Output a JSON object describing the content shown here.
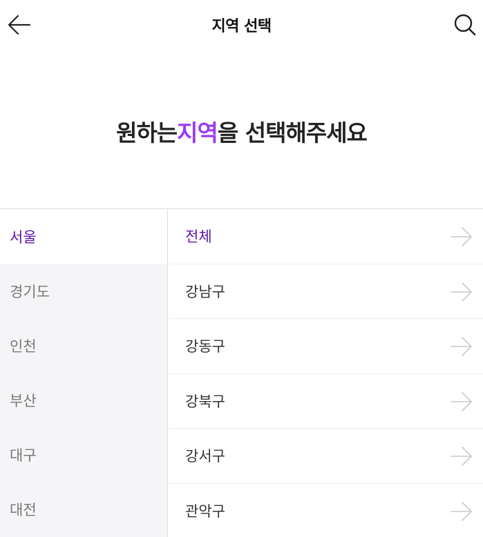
{
  "header": {
    "title": "지역 선택",
    "back_icon": "arrow-left-icon",
    "search_icon": "search-icon"
  },
  "headline": {
    "before": "원하는 ",
    "accent": "지역",
    "after": "을 선택해주세요",
    "accent_color": "#9a3cf0"
  },
  "provinces": [
    {
      "label": "서울",
      "selected": true
    },
    {
      "label": "경기도",
      "selected": false
    },
    {
      "label": "인천",
      "selected": false
    },
    {
      "label": "부산",
      "selected": false
    },
    {
      "label": "대구",
      "selected": false
    },
    {
      "label": "대전",
      "selected": false
    }
  ],
  "districts": [
    {
      "label": "전체",
      "selected": true
    },
    {
      "label": "강남구",
      "selected": false
    },
    {
      "label": "강동구",
      "selected": false
    },
    {
      "label": "강북구",
      "selected": false
    },
    {
      "label": "강서구",
      "selected": false
    },
    {
      "label": "관악구",
      "selected": false
    }
  ],
  "colors": {
    "selected_text": "#5b14a8",
    "sidebar_bg": "#f5f5f7"
  }
}
